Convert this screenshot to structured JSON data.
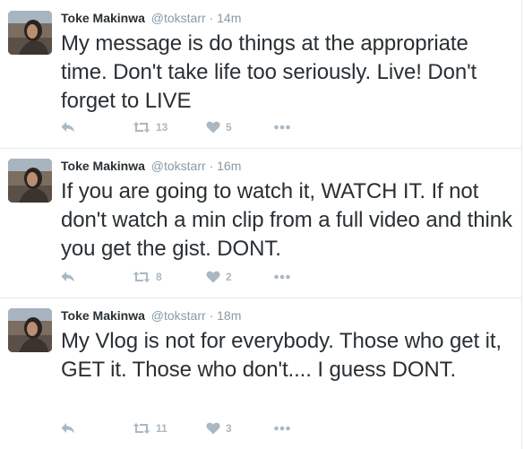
{
  "tweets": [
    {
      "name": "Toke Makinwa",
      "handle": "@tokstarr",
      "separator": "·",
      "time": "14m",
      "text": "My message is do things at the appropriate time. Don't take life too seriously. Live! Don't forget to LIVE",
      "retweets": "13",
      "likes": "5"
    },
    {
      "name": "Toke Makinwa",
      "handle": "@tokstarr",
      "separator": "·",
      "time": "16m",
      "text": "If you are going to watch it, WATCH IT. If not don't watch a min clip from a full video and think you get the gist. DONT.",
      "retweets": "8",
      "likes": "2"
    },
    {
      "name": "Toke Makinwa",
      "handle": "@tokstarr",
      "separator": "·",
      "time": "18m",
      "text": "My Vlog is not for everybody. Those who get it, GET it. Those who don't.... I guess DONT.",
      "retweets": "11",
      "likes": "3"
    }
  ],
  "icons": {
    "reply": "reply-icon",
    "retweet": "retweet-icon",
    "like": "heart-icon",
    "more": "more-icon"
  },
  "colors": {
    "name": "#292f33",
    "muted": "#8899a6",
    "action": "#aab8c2",
    "divider": "#e1e8ed"
  }
}
